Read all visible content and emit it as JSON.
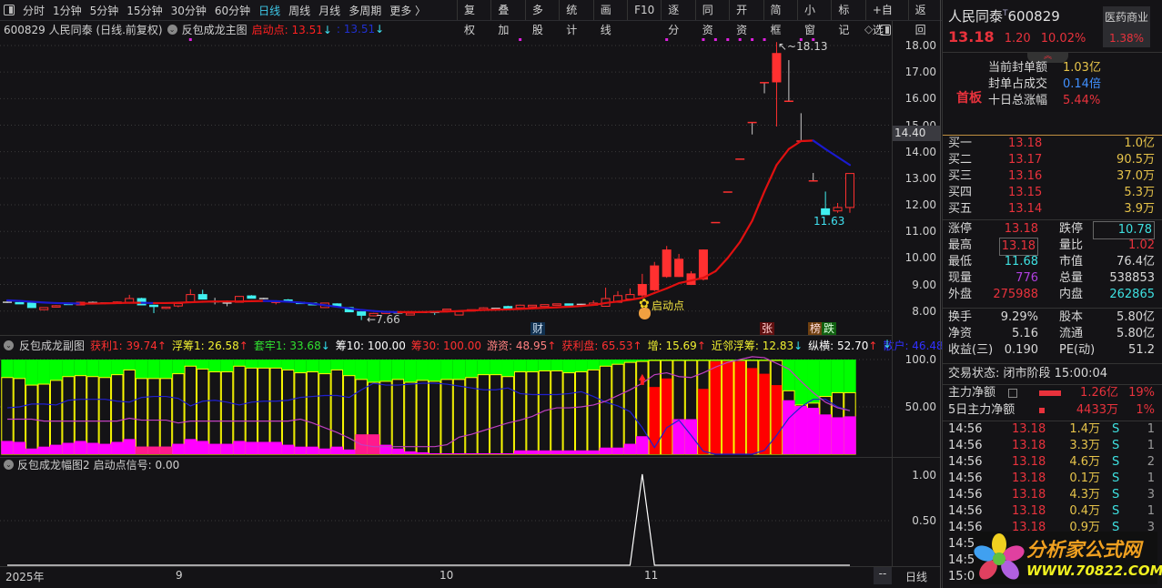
{
  "toolbar": {
    "periods": [
      "分时",
      "1分钟",
      "5分钟",
      "15分钟",
      "30分钟",
      "60分钟",
      "日线",
      "周线",
      "月线",
      "多周期",
      "更多 〉"
    ],
    "active": "日线",
    "buttons": [
      "复权",
      "叠加",
      "多股",
      "统计",
      "画线",
      "F10",
      "逐分",
      "同资",
      "开资",
      "简框",
      "小窗",
      "标记",
      "+自选",
      "返回"
    ]
  },
  "main_header": {
    "stock": "600829 人民同泰 (日线.前复权)",
    "indicator": "反包成龙主图",
    "start_label": "启动点: 13.51",
    "arrow1": "↓",
    "second_value": ": 13.51",
    "arrow2": "↓"
  },
  "main_axis": {
    "labels": [
      "18.00",
      "17.00",
      "16.00",
      "15.00",
      "14.00",
      "13.00",
      "12.00",
      "11.00",
      "10.00",
      "9.00",
      "8.00"
    ],
    "current": "14.40"
  },
  "annotations": {
    "high": "18.13",
    "low": "7.66",
    "recent_low": "11.63",
    "start_point": "启动点",
    "badge_cai": "财",
    "badge_zhang": "张",
    "badge_bang": "榜",
    "badge_die": "跌"
  },
  "sub_header": {
    "title": "反包成龙副图",
    "items": [
      {
        "label": "获利1: 39.74",
        "arrow": "↑",
        "color": "#ff3030",
        "arrow_color": "#ff3030"
      },
      {
        "label": "浮筹1: 26.58",
        "arrow": "↑",
        "color": "#f0f030",
        "arrow_color": "#ff3030"
      },
      {
        "label": "套牢1: 33.68",
        "arrow": "↓",
        "color": "#30e030",
        "arrow_color": "#30e0f0"
      },
      {
        "label": "筹10: 100.00",
        "arrow": "",
        "color": "#ffffff",
        "arrow_color": "#ffffff"
      },
      {
        "label": "筹30: 100.00",
        "arrow": "",
        "color": "#ff3030",
        "arrow_color": "#ff3030"
      },
      {
        "label": "游资: 48.95",
        "arrow": "↑",
        "color": "#ff8080",
        "arrow_color": "#ff3030"
      },
      {
        "label": "获利盘: 65.53",
        "arrow": "↑",
        "color": "#ff3030",
        "arrow_color": "#ff3030"
      },
      {
        "label": "增: 15.69",
        "arrow": "↑",
        "color": "#f0f030",
        "arrow_color": "#ff3030"
      },
      {
        "label": "近邻浮筹: 12.83",
        "arrow": "↓",
        "color": "#f0f030",
        "arrow_color": "#30e0f0"
      },
      {
        "label": "纵横: 52.70",
        "arrow": "↑",
        "color": "#ffffff",
        "arrow_color": "#ff3030"
      },
      {
        "label": "散户: 46.48",
        "arrow": "↓",
        "color": "#3030ff",
        "arrow_color": "#30e0f0"
      }
    ]
  },
  "sub_axis": {
    "labels": [
      "100.0",
      "50.00"
    ]
  },
  "third_header": {
    "title": "反包成龙幅图2",
    "value": "启动点信号: 0.00"
  },
  "third_axis": {
    "labels": [
      "1.00",
      "0.50"
    ]
  },
  "date_axis": {
    "labels": [
      "2025年",
      "9",
      "10",
      "11"
    ],
    "dash": "--",
    "period": "日线"
  },
  "chart_data": {
    "type": "candlestick",
    "price_range": [
      7.5,
      18.5
    ],
    "ohlc": [
      [
        8.33,
        8.36,
        8.3,
        8.33
      ],
      [
        8.32,
        8.34,
        8.28,
        8.3
      ],
      [
        8.3,
        8.31,
        8.12,
        8.13
      ],
      [
        8.05,
        8.14,
        8.04,
        8.13
      ],
      [
        8.15,
        8.22,
        8.14,
        8.2
      ],
      [
        8.3,
        8.31,
        8.23,
        8.24
      ],
      [
        8.23,
        8.35,
        8.22,
        8.33
      ],
      [
        8.32,
        8.36,
        8.3,
        8.32
      ],
      [
        8.3,
        8.33,
        8.28,
        8.3
      ],
      [
        8.28,
        8.36,
        8.27,
        8.34
      ],
      [
        8.33,
        8.61,
        8.32,
        8.47
      ],
      [
        8.47,
        8.5,
        8.22,
        8.23
      ],
      [
        8.22,
        8.24,
        7.92,
        8.2
      ],
      [
        8.1,
        8.16,
        8.08,
        8.15
      ],
      [
        8.19,
        8.3,
        8.14,
        8.28
      ],
      [
        8.35,
        8.82,
        8.33,
        8.62
      ],
      [
        8.62,
        8.8,
        8.44,
        8.45
      ],
      [
        8.35,
        8.5,
        8.25,
        8.35
      ],
      [
        8.3,
        8.4,
        8.18,
        8.3
      ],
      [
        8.33,
        8.56,
        8.32,
        8.55
      ],
      [
        8.57,
        8.6,
        8.47,
        8.48
      ],
      [
        8.47,
        8.5,
        8.44,
        8.47
      ],
      [
        8.33,
        8.38,
        8.25,
        8.37
      ],
      [
        8.42,
        8.45,
        8.33,
        8.35
      ],
      [
        8.33,
        8.35,
        8.28,
        8.29
      ],
      [
        8.3,
        8.31,
        8.22,
        8.23
      ],
      [
        8.13,
        8.31,
        8.12,
        8.3
      ],
      [
        8.27,
        8.29,
        8.15,
        8.16
      ],
      [
        8.13,
        8.14,
        7.96,
        7.97
      ],
      [
        7.97,
        7.98,
        7.66,
        7.84
      ],
      [
        7.82,
        7.93,
        7.8,
        7.91
      ],
      [
        7.91,
        8.0,
        7.9,
        7.98
      ],
      [
        7.93,
        7.95,
        7.9,
        7.93
      ],
      [
        7.85,
        7.93,
        7.84,
        7.92
      ],
      [
        7.95,
        7.97,
        7.93,
        7.95
      ],
      [
        7.99,
        8.0,
        7.85,
        7.98
      ],
      [
        8.02,
        8.08,
        8.01,
        8.07
      ],
      [
        7.85,
        8.0,
        7.84,
        7.98
      ],
      [
        8.02,
        8.06,
        8.01,
        8.05
      ],
      [
        8.06,
        8.14,
        8.05,
        8.12
      ],
      [
        8.1,
        8.12,
        8.08,
        8.1
      ],
      [
        8.17,
        8.2,
        8.1,
        8.11
      ],
      [
        8.12,
        8.24,
        8.11,
        8.22
      ],
      [
        8.16,
        8.23,
        8.15,
        8.22
      ],
      [
        8.17,
        8.25,
        8.16,
        8.24
      ],
      [
        8.25,
        8.28,
        8.24,
        8.27
      ],
      [
        8.27,
        8.28,
        8.2,
        8.22
      ],
      [
        8.25,
        8.27,
        8.24,
        8.25
      ],
      [
        8.22,
        8.4,
        8.21,
        8.3
      ],
      [
        8.18,
        8.88,
        8.17,
        8.47
      ],
      [
        8.33,
        8.75,
        8.32,
        8.58
      ],
      [
        8.45,
        8.85,
        8.44,
        8.62
      ],
      [
        8.6,
        9.4,
        8.5,
        9.0
      ],
      [
        8.8,
        9.85,
        8.75,
        9.7
      ],
      [
        9.3,
        10.45,
        9.25,
        10.3
      ],
      [
        9.3,
        10.15,
        9.28,
        9.95
      ],
      [
        9.0,
        9.5,
        8.98,
        9.4
      ],
      [
        9.2,
        10.32,
        9.15,
        10.3
      ],
      [
        11.33,
        11.33,
        11.33,
        11.33
      ],
      [
        12.48,
        12.48,
        12.48,
        12.48
      ],
      [
        13.72,
        13.72,
        13.72,
        13.72
      ],
      [
        15.1,
        15.1,
        14.65,
        15.1
      ],
      [
        16.6,
        16.6,
        16.2,
        16.6
      ],
      [
        16.63,
        18.13,
        14.95,
        17.7
      ],
      [
        15.9,
        17.45,
        15.9,
        15.9
      ],
      [
        14.4,
        15.45,
        14.4,
        14.4
      ],
      [
        12.9,
        13.2,
        12.9,
        12.9
      ],
      [
        11.85,
        12.5,
        11.63,
        11.63
      ],
      [
        11.77,
        12.07,
        11.7,
        11.9
      ],
      [
        11.9,
        13.18,
        11.7,
        13.18
      ]
    ],
    "ma": [
      8.4,
      8.38,
      8.35,
      8.32,
      8.3,
      8.29,
      8.28,
      8.28,
      8.29,
      8.3,
      8.31,
      8.31,
      8.3,
      8.3,
      8.31,
      8.33,
      8.35,
      8.36,
      8.36,
      8.36,
      8.37,
      8.38,
      8.37,
      8.35,
      8.32,
      8.28,
      8.22,
      8.16,
      8.1,
      8.04,
      8.0,
      7.97,
      7.96,
      7.96,
      7.96,
      7.97,
      7.98,
      8.0,
      8.02,
      8.04,
      8.05,
      8.06,
      8.08,
      8.1,
      8.12,
      8.14,
      8.16,
      8.19,
      8.23,
      8.3,
      8.36,
      8.42,
      8.5,
      8.68,
      8.85,
      9.05,
      9.15,
      9.25,
      9.5,
      10.0,
      10.6,
      11.4,
      12.5,
      13.5,
      14.1,
      14.4,
      14.42,
      14.1,
      13.8,
      13.5
    ],
    "top_markers": [
      15,
      42,
      54,
      57,
      58,
      59,
      60,
      61,
      62,
      65,
      66
    ],
    "sub": {
      "range": [
        0,
        100
      ],
      "bars": [
        81,
        80,
        73,
        74,
        78,
        82,
        83,
        82,
        81,
        84,
        89,
        80,
        80,
        80,
        85,
        93,
        90,
        87,
        87,
        93,
        91,
        91,
        91,
        89,
        86,
        87,
        85,
        89,
        83,
        79,
        76,
        77,
        79,
        76,
        78,
        77,
        79,
        79,
        81,
        84,
        84,
        82,
        87,
        87,
        88,
        88,
        86,
        87,
        89,
        93,
        95,
        97,
        98,
        99,
        99,
        99,
        99,
        99,
        99,
        99,
        99,
        99,
        99,
        99,
        67,
        52,
        54,
        61,
        65,
        65
      ],
      "magenta": [
        14,
        13,
        6,
        8,
        10,
        12,
        14,
        12,
        11,
        13,
        16,
        8,
        8,
        8,
        11,
        16,
        14,
        11,
        11,
        14,
        13,
        13,
        13,
        10,
        8,
        8,
        6,
        8,
        5,
        3,
        3,
        10,
        6,
        3,
        2,
        1,
        1,
        1,
        1,
        1,
        1,
        1,
        4,
        4,
        4,
        4,
        4,
        4,
        4,
        7,
        7,
        11,
        19,
        0,
        0,
        37,
        37,
        0,
        0,
        0,
        0,
        0,
        0,
        0,
        57,
        51,
        49,
        42,
        39,
        40
      ],
      "pink": [
        0,
        0,
        0,
        0,
        0,
        0,
        0,
        0,
        0,
        0,
        0,
        8,
        8,
        8,
        0,
        0,
        0,
        0,
        0,
        0,
        0,
        0,
        0,
        0,
        0,
        0,
        0,
        0,
        0,
        21,
        21,
        0,
        0,
        0,
        0,
        0,
        0,
        0,
        0,
        0,
        0,
        0,
        0,
        0,
        0,
        0,
        0,
        0,
        0,
        0,
        0,
        0,
        0,
        0,
        0,
        0,
        0,
        0,
        0,
        0,
        0,
        0,
        0,
        0,
        0,
        0,
        0,
        0,
        0,
        0
      ],
      "red": [
        0,
        0,
        0,
        0,
        0,
        0,
        0,
        0,
        0,
        0,
        0,
        0,
        0,
        0,
        0,
        0,
        0,
        0,
        0,
        0,
        0,
        0,
        0,
        0,
        0,
        0,
        0,
        0,
        0,
        0,
        0,
        0,
        0,
        0,
        0,
        0,
        0,
        0,
        0,
        0,
        0,
        0,
        0,
        0,
        0,
        0,
        0,
        0,
        0,
        0,
        0,
        0,
        0,
        71,
        80,
        0,
        0,
        69,
        98,
        98,
        98,
        91,
        85,
        73,
        0,
        0,
        0,
        0,
        0,
        0
      ],
      "blue": [
        49,
        50,
        53,
        53,
        52,
        57,
        58,
        58,
        58,
        56,
        55,
        60,
        61,
        61,
        59,
        51,
        56,
        57,
        55,
        52,
        55,
        56,
        56,
        57,
        60,
        61,
        62,
        62,
        60,
        68,
        75,
        73,
        73,
        74,
        75,
        75,
        74,
        72,
        70,
        68,
        68,
        70,
        64,
        63,
        63,
        63,
        64,
        66,
        61,
        55,
        51,
        45,
        28,
        7,
        28,
        36,
        20,
        3,
        0,
        0,
        0,
        0,
        4,
        20,
        38,
        50,
        58,
        58,
        50,
        46
      ],
      "purple": [
        37,
        37,
        37,
        35,
        35,
        35,
        35,
        35,
        35,
        35,
        38,
        36,
        36,
        36,
        33,
        35,
        35,
        35,
        35,
        35,
        35,
        35,
        35,
        35,
        37,
        33,
        28,
        23,
        17,
        10,
        8,
        8,
        8,
        8,
        8,
        8,
        10,
        18,
        21,
        25,
        29,
        33,
        36,
        40,
        46,
        49,
        49,
        50,
        52,
        56,
        62,
        68,
        75,
        84,
        86,
        82,
        81,
        86,
        92,
        97,
        100,
        103,
        102,
        96,
        90,
        77,
        65,
        55,
        49,
        46
      ],
      "arrow_index": 52,
      "arrow_value": 78
    },
    "signal": {
      "range": [
        0,
        1
      ],
      "length": 70,
      "nonzero": [
        [
          52,
          1
        ]
      ]
    }
  },
  "panel": {
    "name": "人民同泰",
    "tag": "T",
    "code": "600829",
    "sector": "医药商业",
    "sector_pct": "1.38%",
    "price": "13.18",
    "change": "1.20",
    "pct": "10.02%",
    "seal": [
      {
        "label": "当前封单额",
        "value": "1.03亿",
        "cls": "y"
      },
      {
        "label": "封单占成交",
        "value": "0.14倍",
        "cls": "b"
      },
      {
        "label": "十日总涨幅",
        "value": "5.44%",
        "cls": "r"
      }
    ],
    "board": "首板",
    "bids": [
      {
        "label": "买一",
        "price": "13.18",
        "vol": "1.0亿"
      },
      {
        "label": "买二",
        "price": "13.17",
        "vol": "90.5万"
      },
      {
        "label": "买三",
        "price": "13.16",
        "vol": "37.0万"
      },
      {
        "label": "买四",
        "price": "13.15",
        "vol": "5.3万"
      },
      {
        "label": "买五",
        "price": "13.14",
        "vol": "3.9万"
      }
    ],
    "stats1": [
      [
        "涨停",
        "13.18",
        "r",
        "跌停",
        "10.78",
        "c"
      ],
      [
        "最高",
        "13.18",
        "r",
        "量比",
        "1.02",
        "r"
      ],
      [
        "最低",
        "11.68",
        "c",
        "市值",
        "76.4亿",
        "w"
      ],
      [
        "现量",
        "776",
        "p",
        "总量",
        "538853",
        "w"
      ],
      [
        "外盘",
        "275988",
        "r",
        "内盘",
        "262865",
        "c"
      ]
    ],
    "stats2": [
      [
        "换手",
        "9.29%",
        "股本",
        "5.80亿"
      ],
      [
        "净资",
        "5.16",
        "流通",
        "5.80亿"
      ],
      [
        "收益(三)",
        "0.190",
        "PE(动)",
        "51.2"
      ]
    ],
    "status": "交易状态: 闭市阶段 15:00:04",
    "flow": [
      {
        "label": "主力净额",
        "value": "1.26亿",
        "pct": "19%"
      },
      {
        "label": "5日主力净额",
        "value": "4433万",
        "pct": "1%"
      }
    ],
    "ticks": [
      [
        "14:56",
        "13.18",
        "1.4万",
        "S",
        "1"
      ],
      [
        "14:56",
        "13.18",
        "3.3万",
        "S",
        "1"
      ],
      [
        "14:56",
        "13.18",
        "4.6万",
        "S",
        "2"
      ],
      [
        "14:56",
        "13.18",
        "0.1万",
        "S",
        "1"
      ],
      [
        "14:56",
        "13.18",
        "4.3万",
        "S",
        "3"
      ],
      [
        "14:56",
        "13.18",
        "0.4万",
        "S",
        "1"
      ],
      [
        "14:56",
        "13.18",
        "0.9万",
        "S",
        "3"
      ],
      [
        "14:5",
        "",
        "",
        "",
        ""
      ],
      [
        "14:5",
        "",
        "",
        "",
        ""
      ],
      [
        "15:0",
        "",
        "",
        "",
        ""
      ]
    ]
  },
  "watermark": {
    "title": "分析家公式网",
    "url": "WWW.70822.COM"
  },
  "colors": {
    "red": "#ff2020",
    "cyan": "#40f0f0",
    "green": "#00ff00",
    "yellow": "#ffff00",
    "magenta": "#ff00ff",
    "pink": "#ff1a8c",
    "blue": "#2020d0",
    "purple": "#c040c0"
  }
}
